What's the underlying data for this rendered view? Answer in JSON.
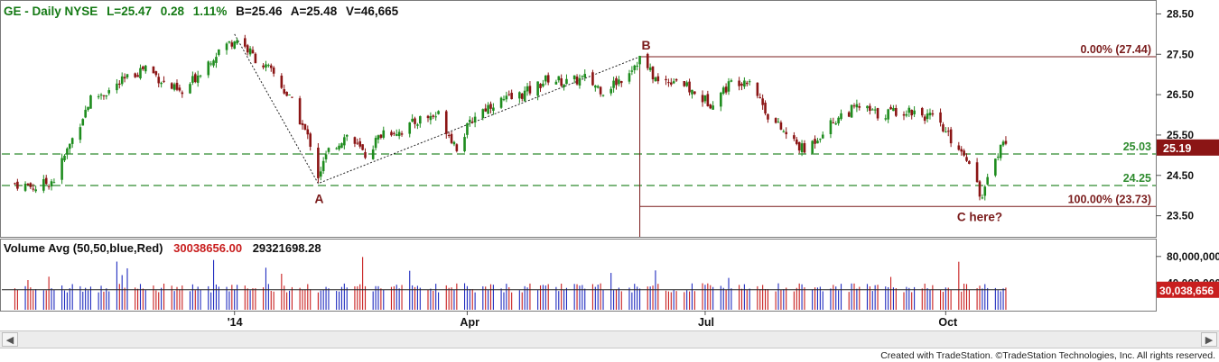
{
  "header": {
    "symbol": "GE - Daily NYSE",
    "last": "L=25.47",
    "change": "0.28",
    "change_pct": "1.11%",
    "bid": "B=25.46",
    "ask": "A=25.48",
    "volume": "V=46,665"
  },
  "volume_header": {
    "label": "Volume Avg (50,50,blue,Red)",
    "value_red": "30038656.00",
    "value_black": "29321698.28"
  },
  "credit": "Created with TradeStation. ©TradeStation Technologies, Inc. All rights reserved.",
  "colors": {
    "up": "#1e8c1e",
    "down": "#8b1515",
    "header_green": "#157a15",
    "fib_line": "#7a1c1c",
    "support_line": "#2e8b2e",
    "vol_up": "#1f2bbf",
    "vol_down": "#c81e1e",
    "price_badge": "#8b1515"
  },
  "chart_data": {
    "type": "line",
    "title": "GE - Daily NYSE",
    "x_axis": {
      "ticks": [
        "'14",
        "Apr",
        "Jul",
        "Oct"
      ]
    },
    "y_axis": {
      "ticks": [
        "28.50",
        "27.50",
        "26.50",
        "25.50",
        "24.50",
        "23.50"
      ],
      "range": [
        23.0,
        28.8
      ]
    },
    "series": [
      {
        "name": "",
        "x": [
          "2013-10-10",
          "2013-10-18",
          "2013-10-25",
          "2013-11-01",
          "2013-11-08",
          "2013-11-15",
          "2013-11-22",
          "2013-11-29",
          "2013-12-06",
          "2013-12-13",
          "2013-12-20",
          "2013-12-27",
          "2014-01-03",
          "2014-01-10",
          "2014-01-17",
          "2014-01-24",
          "2014-01-31",
          "2014-02-03",
          "2014-02-07",
          "2014-02-14",
          "2014-02-21",
          "2014-02-28",
          "2014-03-07",
          "2014-03-14",
          "2014-03-21",
          "2014-03-28",
          "2014-04-04",
          "2014-04-11",
          "2014-04-18",
          "2014-04-25",
          "2014-05-02",
          "2014-05-09",
          "2014-05-16",
          "2014-05-23",
          "2014-05-30",
          "2014-06-06",
          "2014-06-13",
          "2014-06-20",
          "2014-06-27",
          "2014-07-03",
          "2014-07-11",
          "2014-07-18",
          "2014-07-25",
          "2014-08-01",
          "2014-08-08",
          "2014-08-15",
          "2014-08-22",
          "2014-08-29",
          "2014-09-05",
          "2014-09-12",
          "2014-09-19",
          "2014-09-26",
          "2014-10-03",
          "2014-10-10",
          "2014-10-15",
          "2014-10-20",
          "2014-10-24"
        ],
        "values": [
          24.3,
          24.2,
          24.4,
          25.4,
          26.4,
          26.6,
          26.9,
          27.2,
          26.8,
          26.5,
          27.1,
          27.6,
          27.9,
          27.4,
          27.0,
          26.3,
          25.3,
          24.5,
          25.1,
          25.5,
          25.0,
          25.6,
          25.6,
          25.9,
          26.0,
          25.2,
          26.0,
          26.3,
          26.4,
          26.6,
          26.9,
          26.8,
          26.9,
          26.6,
          26.9,
          27.4,
          26.8,
          26.9,
          26.5,
          26.3,
          26.8,
          26.9,
          26.0,
          25.5,
          25.1,
          25.6,
          26.0,
          26.2,
          26.0,
          26.1,
          26.1,
          25.9,
          25.4,
          24.9,
          23.9,
          25.0,
          25.4
        ]
      }
    ],
    "annotations": {
      "points": [
        {
          "label": "A",
          "x": "2014-02-03",
          "y": 24.3
        },
        {
          "label": "B",
          "x": "2014-06-06",
          "y": 27.44
        }
      ],
      "fib_levels": [
        {
          "label": "0.00% (27.44)",
          "y": 27.44
        },
        {
          "label": "100.00% (23.73)",
          "y": 23.73
        }
      ],
      "support_levels": [
        {
          "label": "25.03",
          "y": 25.03
        },
        {
          "label": "24.25",
          "y": 24.25
        }
      ],
      "target_note": "C here?",
      "last_price_badge": "25.19"
    },
    "volume": {
      "y_axis": {
        "ticks": [
          "80,000,000",
          "40,000,000"
        ],
        "range": [
          0,
          100000000
        ]
      },
      "last_badge": "30,038,656",
      "average": 30000000
    }
  }
}
